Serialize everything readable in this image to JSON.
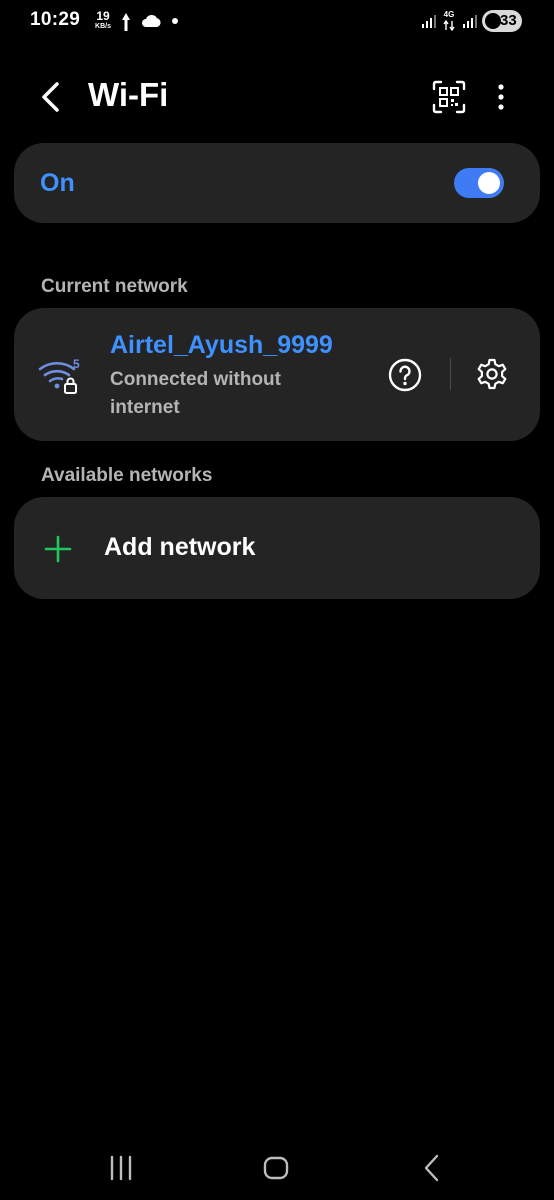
{
  "status_bar": {
    "time": "10:29",
    "net_speed_value": "19",
    "net_speed_unit": "KB/s",
    "network_type": "4G",
    "battery_level": "33",
    "icons": [
      "upload-icon",
      "cloud-icon",
      "dot-icon",
      "signal-icon",
      "data-arrows-icon",
      "signal-icon",
      "battery-saver-icon"
    ]
  },
  "header": {
    "title": "Wi-Fi",
    "icons": [
      "back-arrow-icon",
      "qr-scan-icon",
      "more-vert-icon"
    ]
  },
  "wifi_toggle": {
    "label": "On",
    "enabled": true
  },
  "current_network": {
    "section_label": "Current network",
    "ssid": "Airtel_Ayush_9999",
    "status": "Connected without internet",
    "band": "5",
    "icons": [
      "wifi-lock-icon",
      "help-icon",
      "settings-gear-icon"
    ]
  },
  "available_networks": {
    "section_label": "Available networks",
    "add_label": "Add network",
    "icons": [
      "plus-icon"
    ]
  },
  "nav_bar": {
    "icons": [
      "recents-icon",
      "home-icon",
      "back-icon"
    ]
  },
  "colors": {
    "background": "#000000",
    "card": "#242424",
    "accent": "#3e91ff",
    "switch": "#3e7bf5",
    "secondary_text": "#b4b4b4",
    "plus": "#22c55e"
  }
}
